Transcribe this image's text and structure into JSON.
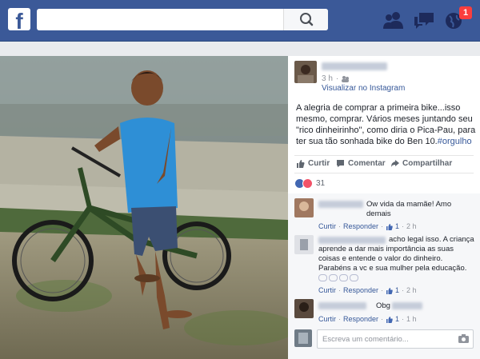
{
  "topbar": {
    "logo": "f",
    "search_placeholder": "",
    "notification_count": "1",
    "icons": [
      "search-icon",
      "friends-icon",
      "messages-icon",
      "globe-icon"
    ]
  },
  "post": {
    "time": "3 h",
    "source_link": "Visualizar no Instagram",
    "text_main": "A alegria de comprar a primeira bike...isso mesmo, comprar. Vários meses juntando seu \"rico dinheirinho\", como diria o Pica-Pau, para ter sua tão sonhada bike do Ben 10.",
    "hashtag": "#orgulho",
    "actions": {
      "like": "Curtir",
      "comment": "Comentar",
      "share": "Compartilhar"
    },
    "reaction_count": "31"
  },
  "comments": [
    {
      "text": "Ow vida da mamãe! Amo demais",
      "reply": "Responder",
      "likes": "1",
      "time": "2 h",
      "like_label": "Curtir"
    },
    {
      "text": "acho legal isso. A criança aprende a dar mais importância as suas coisas e entende o valor do dinheiro. Parabéns a vc e sua mulher pela educação.",
      "reply": "Responder",
      "likes": "1",
      "time": "2 h",
      "like_label": "Curtir"
    },
    {
      "text": "Obg",
      "reply": "Responder",
      "likes": "1",
      "time": "1 h",
      "like_label": "Curtir"
    }
  ],
  "composer": {
    "placeholder": "Escreva um comentário..."
  },
  "colors": {
    "brand": "#3b5998",
    "link": "#365899",
    "badge": "#fa3e3e"
  }
}
